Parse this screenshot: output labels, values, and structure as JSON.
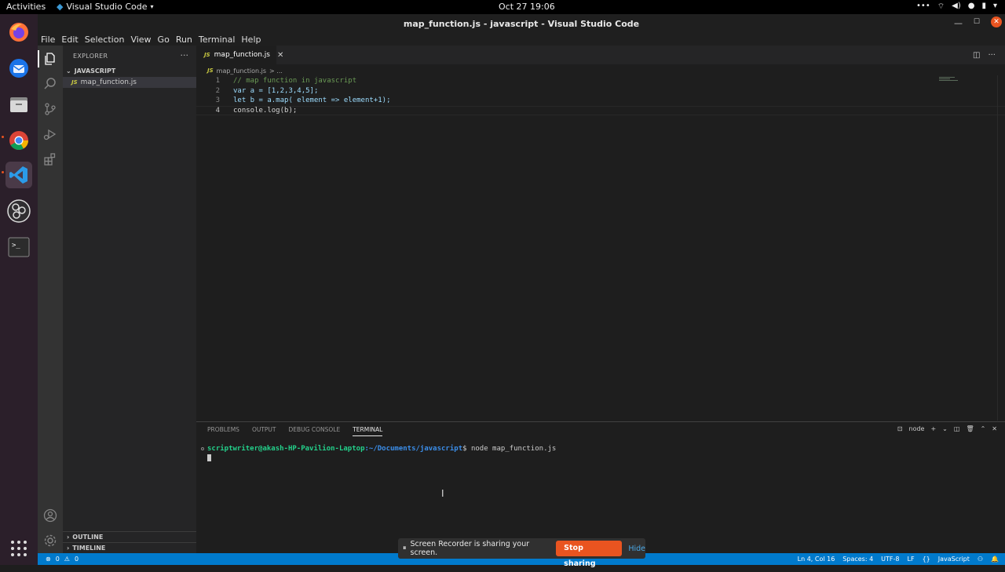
{
  "topbar": {
    "activities": "Activities",
    "app_name": "Visual Studio Code",
    "clock": "Oct 27  19:06"
  },
  "window": {
    "title": "map_function.js - javascript - Visual Studio Code"
  },
  "menu": [
    "File",
    "Edit",
    "Selection",
    "View",
    "Go",
    "Run",
    "Terminal",
    "Help"
  ],
  "sidebar": {
    "header": "EXPLORER",
    "folder": "JAVASCRIPT",
    "file": "map_function.js",
    "outline": "OUTLINE",
    "timeline": "TIMELINE"
  },
  "editor": {
    "tab": "map_function.js",
    "breadcrumb_file": "map_function.js",
    "breadcrumb_more": "> ...",
    "file_badge": "JS",
    "lines": [
      {
        "n": "1",
        "text": "// map function in javascript"
      },
      {
        "n": "2",
        "text": "var a = [1,2,3,4,5];"
      },
      {
        "n": "3",
        "text": "let b = a.map( element => element+1);"
      },
      {
        "n": "4",
        "text": "console.log(b);"
      }
    ]
  },
  "panel": {
    "tabs": [
      "PROBLEMS",
      "OUTPUT",
      "DEBUG CONSOLE",
      "TERMINAL"
    ],
    "active_tab": "TERMINAL",
    "terminal_name": "node",
    "prompt_user": "scriptwriter@akash-HP-Pavilion-Laptop",
    "prompt_path": ":~/Documents/javascript",
    "prompt_sign": "$ ",
    "command": "node map_function.js"
  },
  "statusbar": {
    "errors": "0",
    "warnings": "0",
    "cursor": "Ln 4, Col 16",
    "spaces": "Spaces: 4",
    "encoding": "UTF-8",
    "eol": "LF",
    "language": "JavaScript"
  },
  "share": {
    "message": "Screen Recorder is sharing your screen.",
    "stop": "Stop sharing",
    "hide": "Hide"
  },
  "colors": {
    "accent": "#007acc",
    "ubuntu_orange": "#e95420"
  }
}
